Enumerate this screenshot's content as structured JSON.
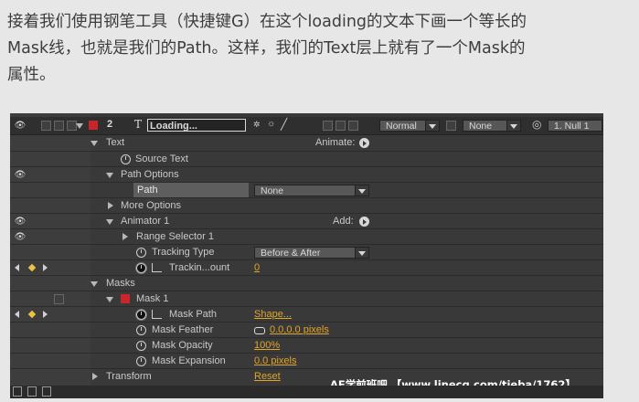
{
  "caption": {
    "line1": "接着我们使用钢笔工具（快捷键G）在这个loading的文本下画一个等长的",
    "line2": "Mask线，也就是我们的Path。这样，我们的Text层上就有了一个Mask的",
    "line3": "属性。"
  },
  "layer": {
    "number": "2",
    "type_icon": "T",
    "name": "Loading...",
    "mode": "Normal",
    "trkmat": "None",
    "parent": "1. Null 1"
  },
  "props": {
    "text": "Text",
    "animate_label": "Animate:",
    "source_text": "Source Text",
    "path_options": "Path Options",
    "path": "Path",
    "path_value": "None",
    "more_options": "More Options",
    "animator": "Animator 1",
    "add_label": "Add:",
    "range_selector": "Range Selector 1",
    "tracking_type": "Tracking Type",
    "tracking_type_value": "Before & After",
    "tracking_amount": "Trackin...ount",
    "tracking_amount_value": "0",
    "masks": "Masks",
    "mask1": "Mask 1",
    "mask_path": "Mask Path",
    "mask_path_value": "Shape...",
    "mask_feather": "Mask Feather",
    "mask_feather_value": "0.0,0.0 pixels",
    "mask_opacity": "Mask Opacity",
    "mask_opacity_value": "100%",
    "mask_expansion": "Mask Expansion",
    "mask_expansion_value": "0.0 pixels",
    "transform": "Transform",
    "transform_value": "Reset"
  },
  "watermark": "AE学前班吧 【www.linecg.com/tieba/1762】",
  "colors": {
    "accent": "#e2a52b",
    "label_red": "#c8262b",
    "panel_bg": "#393939"
  }
}
